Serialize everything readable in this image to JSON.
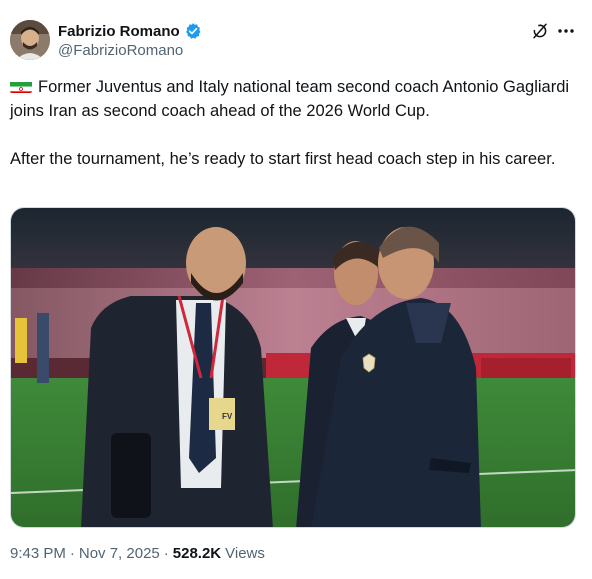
{
  "author": {
    "display_name": "Fabrizio Romano",
    "handle": "@FabrizioRomano",
    "verified_icon": "verified-badge-icon",
    "accent_color": "#1d9bf0"
  },
  "header_actions": {
    "grok_icon": "grok-icon",
    "more_icon": "more-icon"
  },
  "tweet": {
    "flag_icon": "iran-flag-icon",
    "paragraph_1": "Former Juventus and Italy national team second coach Antonio Gagliardi joins Iran as second coach ahead of the 2026 World Cup.",
    "paragraph_2": "After the tournament, he’s ready to start first head coach step in his career."
  },
  "media": {
    "description": "photo",
    "badge_text": "FV"
  },
  "meta": {
    "time": "9:43 PM",
    "separator_1": "·",
    "date": "Nov 7, 2025",
    "separator_2": "·",
    "views_count": "528.2K",
    "views_label": "Views"
  }
}
